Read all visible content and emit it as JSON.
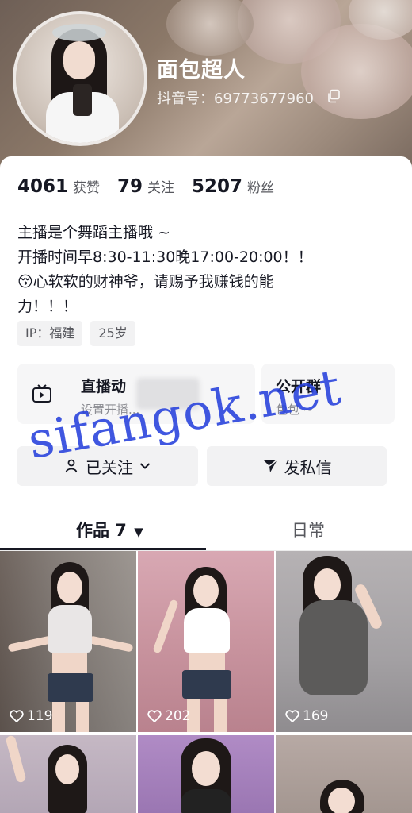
{
  "profile": {
    "nickname": "面包超人",
    "douyin_id": "抖音号：69773677960"
  },
  "stats": [
    {
      "value": "4061",
      "label": "获赞"
    },
    {
      "value": "79",
      "label": "关注"
    },
    {
      "value": "5207",
      "label": "粉丝"
    }
  ],
  "bio": [
    "主播是个舞蹈主播哦 ~",
    "开播时间早8:30-11:30晚17:00-20:00！！",
    "😚心软软的财神爷，请赐予我赚钱的能",
    "力！！！"
  ],
  "tags": [
    "IP：福建",
    "25岁"
  ],
  "tiles": {
    "live": {
      "title": "直播动",
      "subtitle": "设置开播..."
    },
    "group": {
      "title": "公开群",
      "subtitle": "包包 ~"
    }
  },
  "buttons": {
    "follow": "已关注",
    "message": "发私信"
  },
  "tabs": {
    "works": "作品 7",
    "daily": "日常"
  },
  "posts": [
    {
      "likes": "119"
    },
    {
      "likes": "202"
    },
    {
      "likes": "169"
    }
  ],
  "watermark": "sifangok.net",
  "colors": {
    "text": "#161823",
    "muted": "#57585e",
    "chip_bg": "#f2f2f3",
    "watermark": "#2640dc"
  }
}
